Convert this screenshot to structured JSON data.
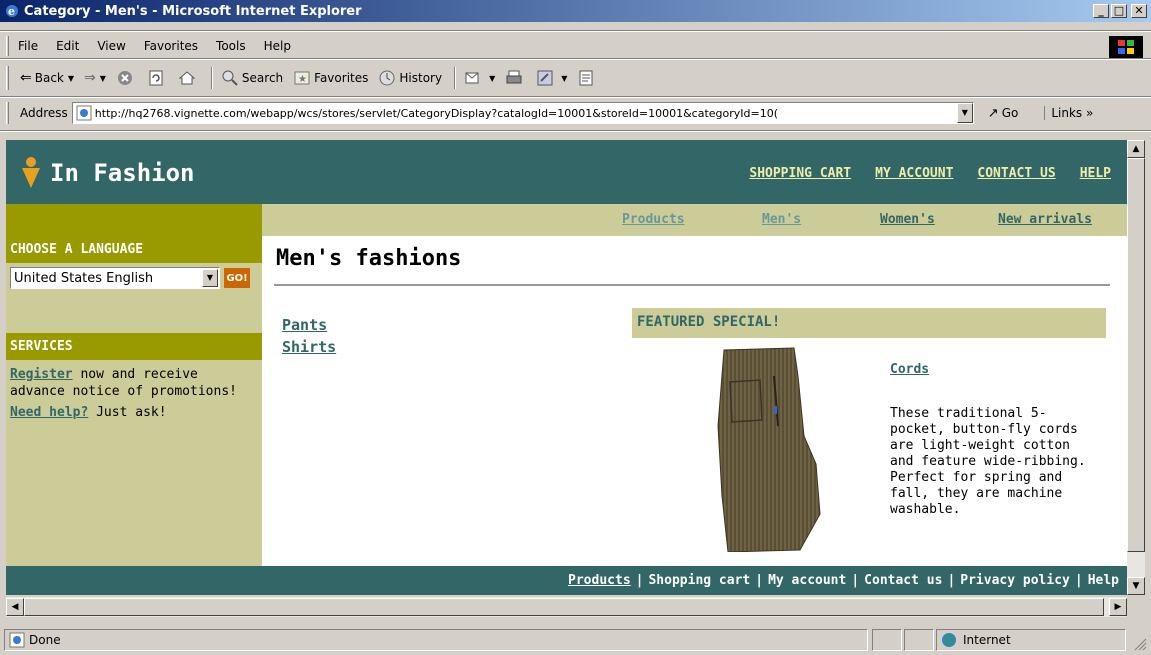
{
  "window": {
    "title": "Category - Men's - Microsoft Internet Explorer",
    "minimize": "_",
    "maximize": "□",
    "close": "✕"
  },
  "menu": [
    "File",
    "Edit",
    "View",
    "Favorites",
    "Tools",
    "Help"
  ],
  "toolbar": {
    "back": "Back",
    "search": "Search",
    "favorites": "Favorites",
    "history": "History"
  },
  "address": {
    "label": "Address",
    "url": "http://hq2768.vignette.com/webapp/wcs/stores/servlet/CategoryDisplay?catalogId=10001&storeId=10001&categoryId=10(",
    "go": "Go",
    "links": "Links »"
  },
  "site": {
    "brand": "In Fashion",
    "top_nav": [
      "SHOPPING CART",
      "MY ACCOUNT",
      "CONTACT US",
      "HELP"
    ],
    "sub_nav": [
      "Products",
      "Men's",
      "Women's",
      "New arrivals"
    ],
    "language_heading": "CHOOSE A LANGUAGE",
    "language_value": "United States English",
    "language_go": "GO!",
    "services_heading": "SERVICES",
    "register_link": "Register",
    "register_text": " now and receive advance notice of promotions!",
    "help_link": "Need help?",
    "help_text": " Just ask!",
    "page_title": "Men's fashions",
    "categories": [
      "Pants",
      "Shirts"
    ],
    "featured_heading": "FEATURED SPECIAL!",
    "product_name": "Cords",
    "product_description": "These traditional 5-pocket, button-fly cords are light-weight cotton and feature wide-ribbing. Perfect for spring and fall, they are machine washable.",
    "footer": [
      "Products",
      "Shopping cart",
      "My account",
      "Contact us",
      "Privacy policy",
      "Help"
    ]
  },
  "status": {
    "text": "Done",
    "zone": "Internet"
  },
  "colors": {
    "header": "#336666",
    "sidebar": "#cccc99",
    "sidebar_heading": "#999900",
    "link": "#336666"
  }
}
